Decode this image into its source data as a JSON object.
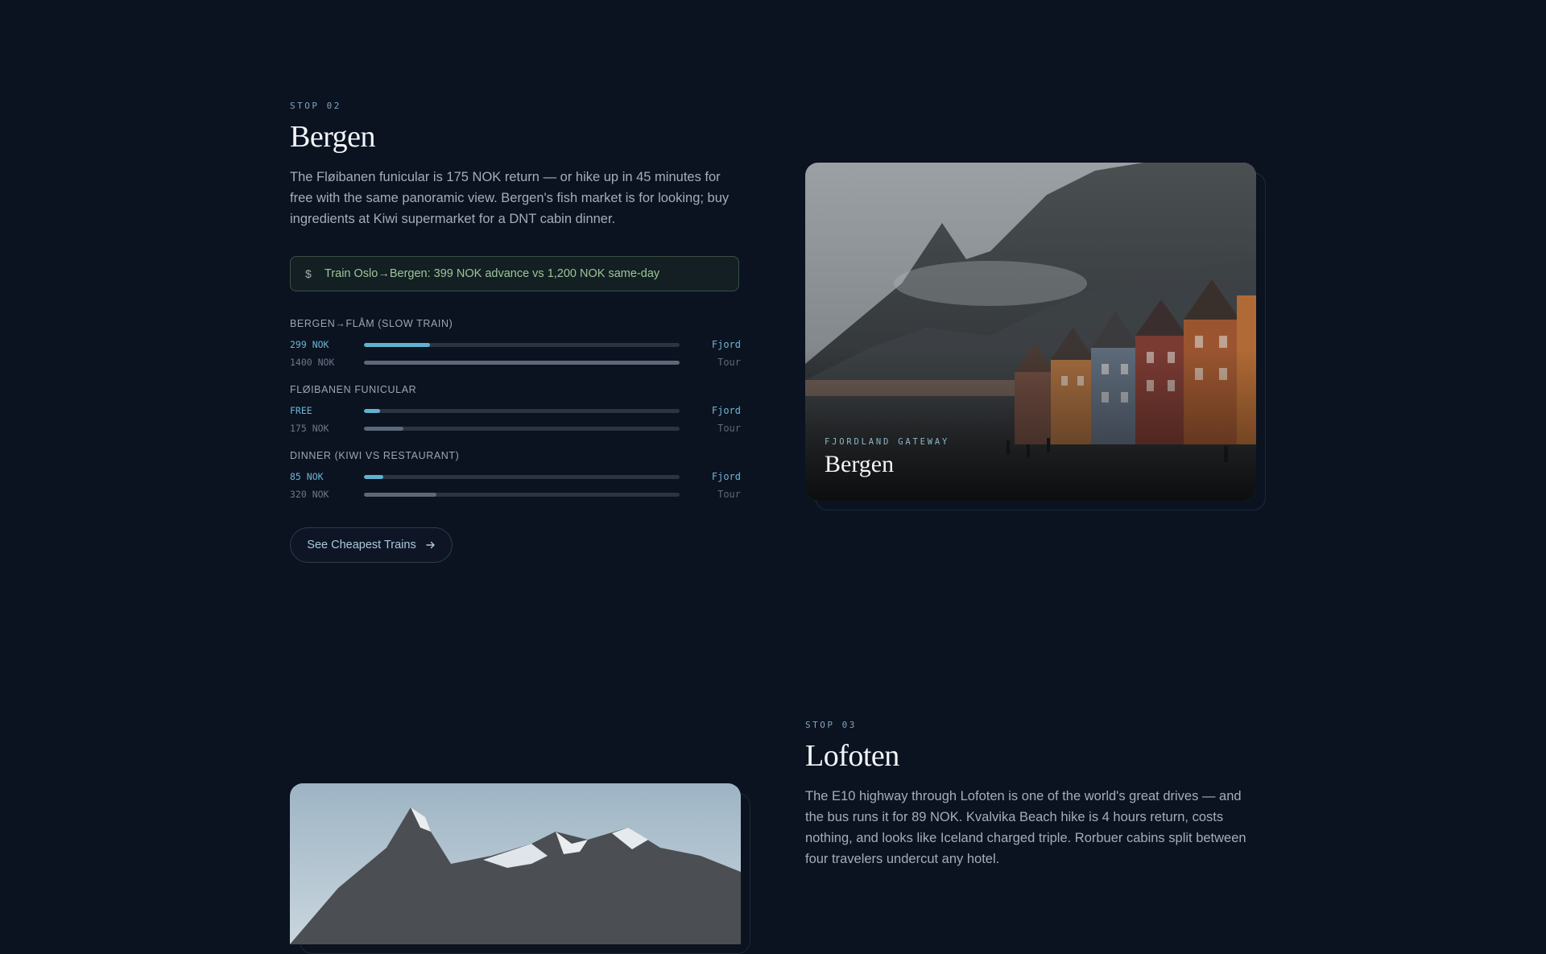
{
  "stop02": {
    "eyebrow": "STOP 02",
    "title": "Bergen",
    "description": "The Fløibanen funicular is 175 NOK return — or hike up in 45 minutes for free with the same panoramic view. Bergen's fish market is for looking; buy ingredients at Kiwi supermarket for a DNT cabin dinner.",
    "tip": {
      "icon": "dollar-icon",
      "text": "Train Oslo→Bergen: 399 NOK advance vs 1,200 NOK same-day"
    },
    "comparisons": [
      {
        "title": "BERGEN→FLÅM (SLOW TRAIN)",
        "a": {
          "label": "299 NOK",
          "tag": "Fjord",
          "fraction": 0.21
        },
        "b": {
          "label": "1400 NOK",
          "tag": "Tour",
          "fraction": 1.0
        }
      },
      {
        "title": "FLØIBANEN FUNICULAR",
        "a": {
          "label": "FREE",
          "tag": "Fjord",
          "fraction": 0.05
        },
        "b": {
          "label": "175 NOK",
          "tag": "Tour",
          "fraction": 0.125
        }
      },
      {
        "title": "DINNER (KIWI VS RESTAURANT)",
        "a": {
          "label": "85 NOK",
          "tag": "Fjord",
          "fraction": 0.06
        },
        "b": {
          "label": "320 NOK",
          "tag": "Tour",
          "fraction": 0.23
        }
      }
    ],
    "cta": {
      "label": "See Cheapest Trains",
      "icon": "arrow-right-icon"
    },
    "image": {
      "eyebrow": "FJORDLAND GATEWAY",
      "title": "Bergen"
    }
  },
  "stop03": {
    "eyebrow": "STOP 03",
    "title": "Lofoten",
    "description": "The E10 highway through Lofoten is one of the world's great drives — and the bus runs it for 89 NOK. Kvalvika Beach hike is 4 hours return, costs nothing, and looks like Iceland charged triple. Rorbuer cabins split between four travelers undercut any hotel."
  },
  "colors": {
    "background": "#0b1220",
    "accent": "#5fb3d0",
    "tip_text": "#9cc59a"
  }
}
